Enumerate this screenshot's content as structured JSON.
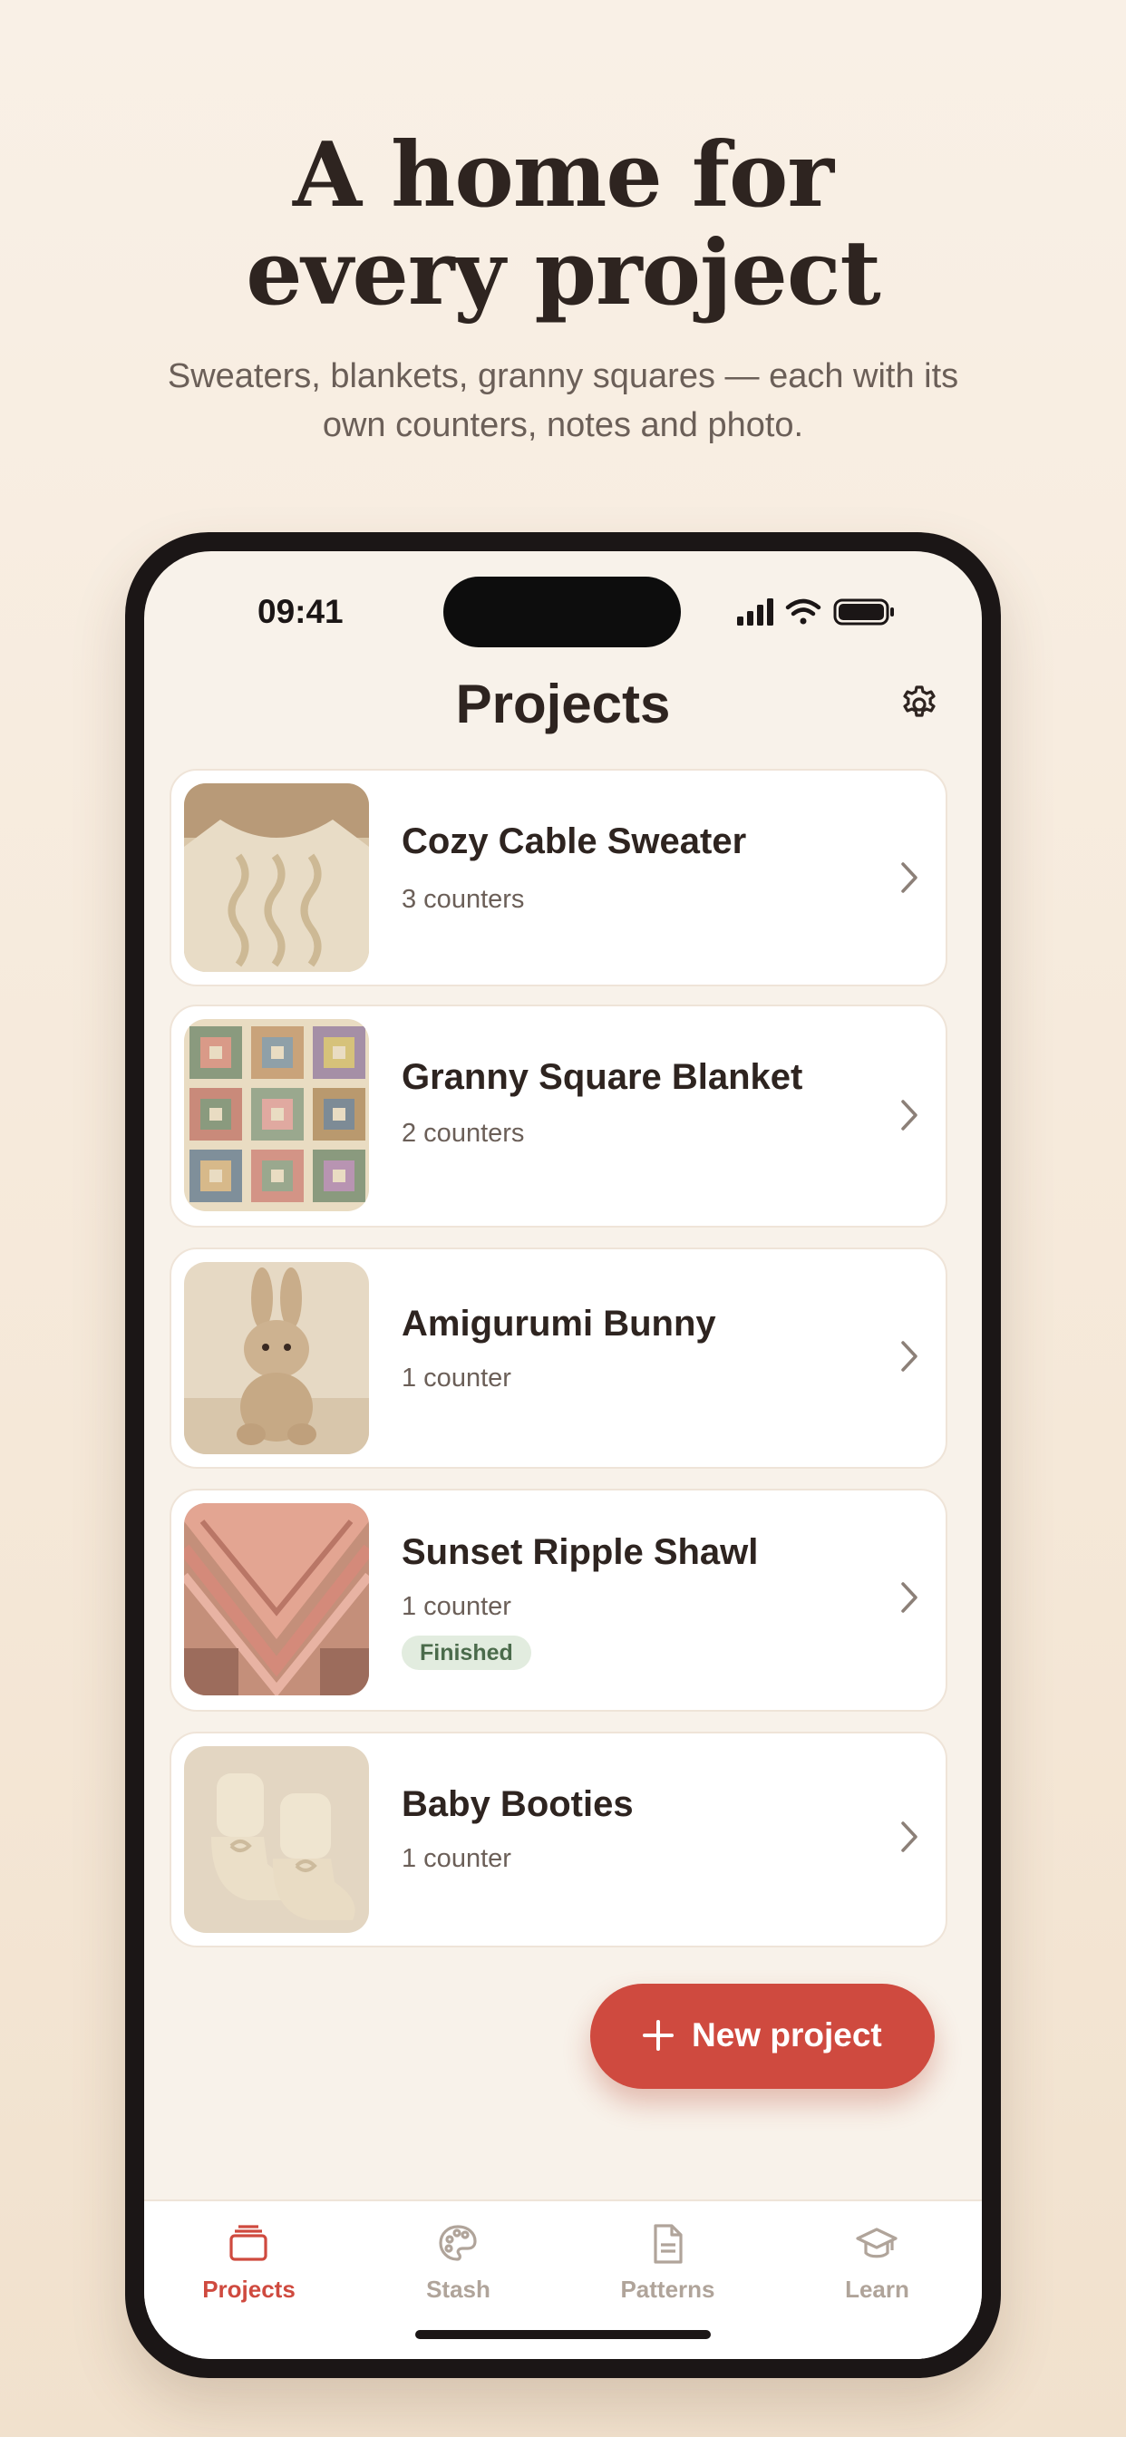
{
  "marketing": {
    "headline_line1": "A home for",
    "headline_line2": "every project",
    "subhead_line1": "Sweaters, blankets, granny squares — each with its",
    "subhead_line2": "own counters, notes and photo."
  },
  "status_bar": {
    "time": "09:41",
    "icons": [
      "cellular-signal-icon",
      "wifi-icon",
      "battery-icon"
    ]
  },
  "header": {
    "title": "Projects",
    "settings_icon": "gear-icon"
  },
  "projects": [
    {
      "name": "Cozy Cable Sweater",
      "counters": "3 counters",
      "badge": "",
      "thumb_icon": "sweater-photo"
    },
    {
      "name": "Granny Square Blanket",
      "counters": "2 counters",
      "badge": "",
      "thumb_icon": "blanket-photo"
    },
    {
      "name": "Amigurumi Bunny",
      "counters": "1 counter",
      "badge": "",
      "thumb_icon": "bunny-photo"
    },
    {
      "name": "Sunset Ripple Shawl",
      "counters": "1 counter",
      "badge": "Finished",
      "thumb_icon": "shawl-photo"
    },
    {
      "name": "Baby Booties",
      "counters": "1 counter",
      "badge": "",
      "thumb_icon": "booties-photo"
    }
  ],
  "fab": {
    "label": "New project",
    "icon": "plus-icon"
  },
  "tab_bar": {
    "active_color": "#cf4a3f",
    "inactive_color": "#b0a49a",
    "items": [
      {
        "label": "Projects",
        "icon": "projects-icon",
        "active": true
      },
      {
        "label": "Stash",
        "icon": "palette-icon",
        "active": false
      },
      {
        "label": "Patterns",
        "icon": "document-icon",
        "active": false
      },
      {
        "label": "Learn",
        "icon": "graduation-cap-icon",
        "active": false
      }
    ]
  },
  "colors": {
    "accent": "#cf4a3f",
    "text": "#2e2420",
    "finished_badge_bg": "#e2ecdf"
  }
}
